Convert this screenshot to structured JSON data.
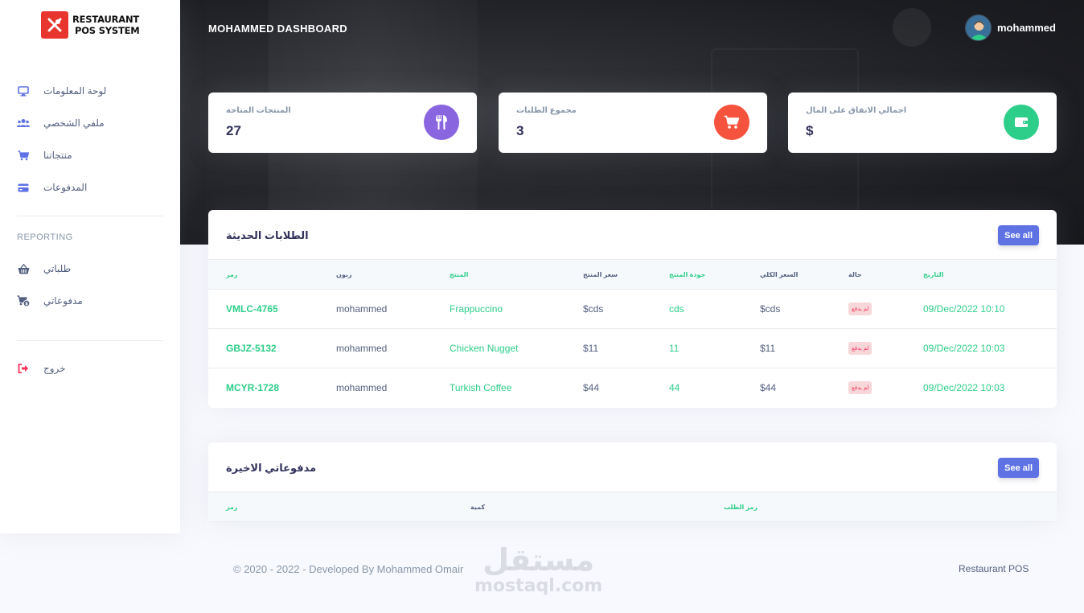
{
  "brand": {
    "line1": "RESTAURANT",
    "line2": "POS SYSTEM"
  },
  "sidebar": {
    "items": [
      {
        "label": "لوحة المعلومات",
        "icon": "monitor-icon"
      },
      {
        "label": "ملفي الشخصي",
        "icon": "users-icon"
      },
      {
        "label": "منتجاتنا",
        "icon": "cart-icon"
      },
      {
        "label": "المدفوعات",
        "icon": "credit-card-icon"
      }
    ],
    "reporting_heading": "REPORTING",
    "report_items": [
      {
        "label": "طلباتي",
        "icon": "basket-icon"
      },
      {
        "label": "مدفوعاتي",
        "icon": "cart-dollar-icon"
      }
    ],
    "logout_label": "خروج"
  },
  "header": {
    "title": "MOHAMMED DASHBOARD",
    "user_name": "mohammed"
  },
  "stats": [
    {
      "title": "المنتجات المتاحة",
      "value": "27",
      "color": "#8965e0",
      "icon": "utensils-icon"
    },
    {
      "title": "مجموع الطلبات",
      "value": "3",
      "color": "#f5533d",
      "icon": "cart-icon"
    },
    {
      "title": "اجمالي الانفاق على المال",
      "value": "$",
      "color": "#2dce89",
      "icon": "wallet-icon"
    }
  ],
  "orders": {
    "title": "الطلابات الحديثة",
    "see_all": "See all",
    "headers": [
      "رمز",
      "زبون",
      "المنتج",
      "سعر المنتج",
      "جودة المنتج",
      "السعر الكلي",
      "حالة",
      "التاريخ"
    ],
    "rows": [
      {
        "code": "VMLC-4765",
        "customer": "mohammed",
        "product": "Frappuccino",
        "price": "$cds",
        "qty": "cds",
        "total": "$cds",
        "status": "لم يدفع",
        "date": "09/Dec/2022 10:10"
      },
      {
        "code": "GBJZ-5132",
        "customer": "mohammed",
        "product": "Chicken Nugget",
        "price": "$11",
        "qty": "11",
        "total": "$11",
        "status": "لم يدفع",
        "date": "09/Dec/2022 10:03"
      },
      {
        "code": "MCYR-1728",
        "customer": "mohammed",
        "product": "Turkish Coffee",
        "price": "$44",
        "qty": "44",
        "total": "$44",
        "status": "لم يدفع",
        "date": "09/Dec/2022 10:03"
      }
    ]
  },
  "payments": {
    "title": "مدفوعاتي الاخيرة",
    "see_all": "See all",
    "headers": [
      "رمز",
      "كمية",
      "رمز الطلب"
    ]
  },
  "footer": {
    "copyright": "© 2020 - 2022 - Developed By Mohammed Omair",
    "right": "Restaurant POS"
  },
  "watermark": {
    "line1": "مستقل",
    "line2": "mostaql.com"
  }
}
